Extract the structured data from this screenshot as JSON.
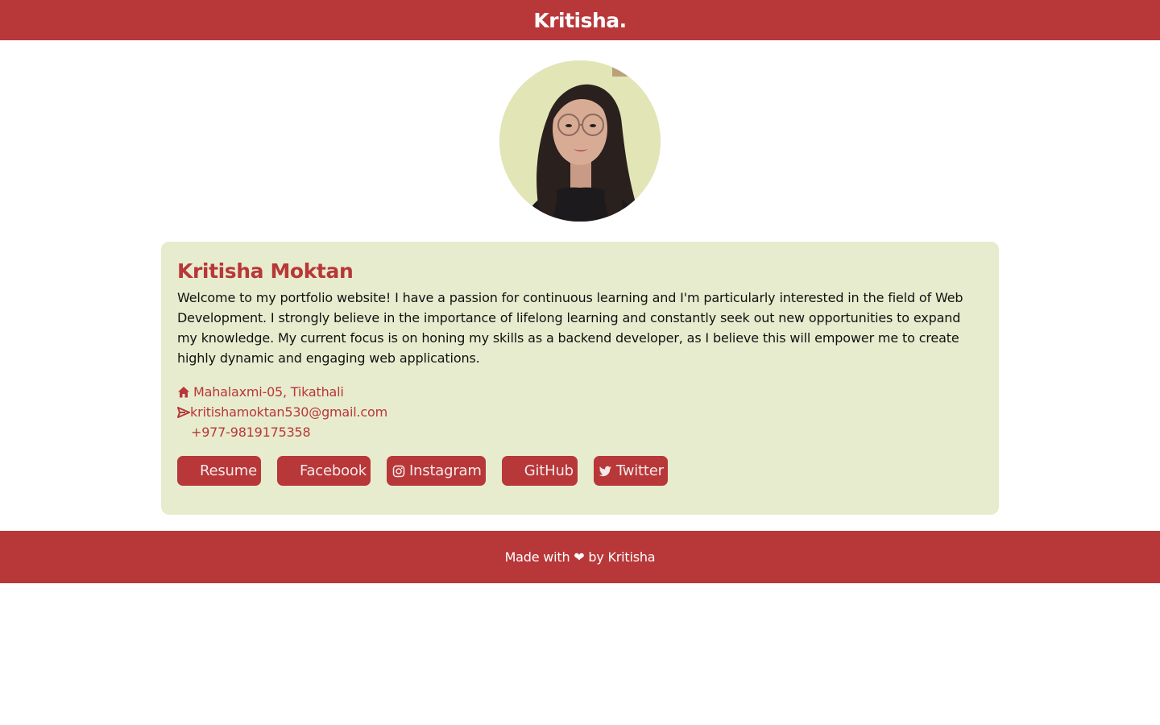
{
  "header": {
    "brand": "Kritisha."
  },
  "profile": {
    "avatar_alt": "profile photo",
    "name": "Kritisha Moktan",
    "bio": "Welcome to my portfolio website! I have a passion for continuous learning and I'm particularly interested in the field of Web Development. I strongly believe in the importance of lifelong learning and constantly seek out new opportunities to expand my knowledge. My current focus is on honing my skills as a backend developer, as I believe this will empower me to create highly dynamic and engaging web applications."
  },
  "contacts": {
    "address": "Mahalaxmi-05, Tikathali",
    "address_icon": "home-icon",
    "email": "kritishamoktan530@gmail.com",
    "email_icon": "send-icon",
    "phone": "+977-9819175358",
    "phone_icon": "phone-icon"
  },
  "links": [
    {
      "label": "Resume",
      "icon": "file-icon"
    },
    {
      "label": "Facebook",
      "icon": "facebook-icon"
    },
    {
      "label": "Instagram",
      "icon": "instagram-icon"
    },
    {
      "label": "GitHub",
      "icon": "github-icon"
    },
    {
      "label": "Twitter",
      "icon": "twitter-icon"
    }
  ],
  "footer": {
    "text": "Made with ❤ by Kritisha"
  },
  "colors": {
    "accent": "#b83739",
    "card_bg": "#e8ecce",
    "text": "#111111"
  }
}
